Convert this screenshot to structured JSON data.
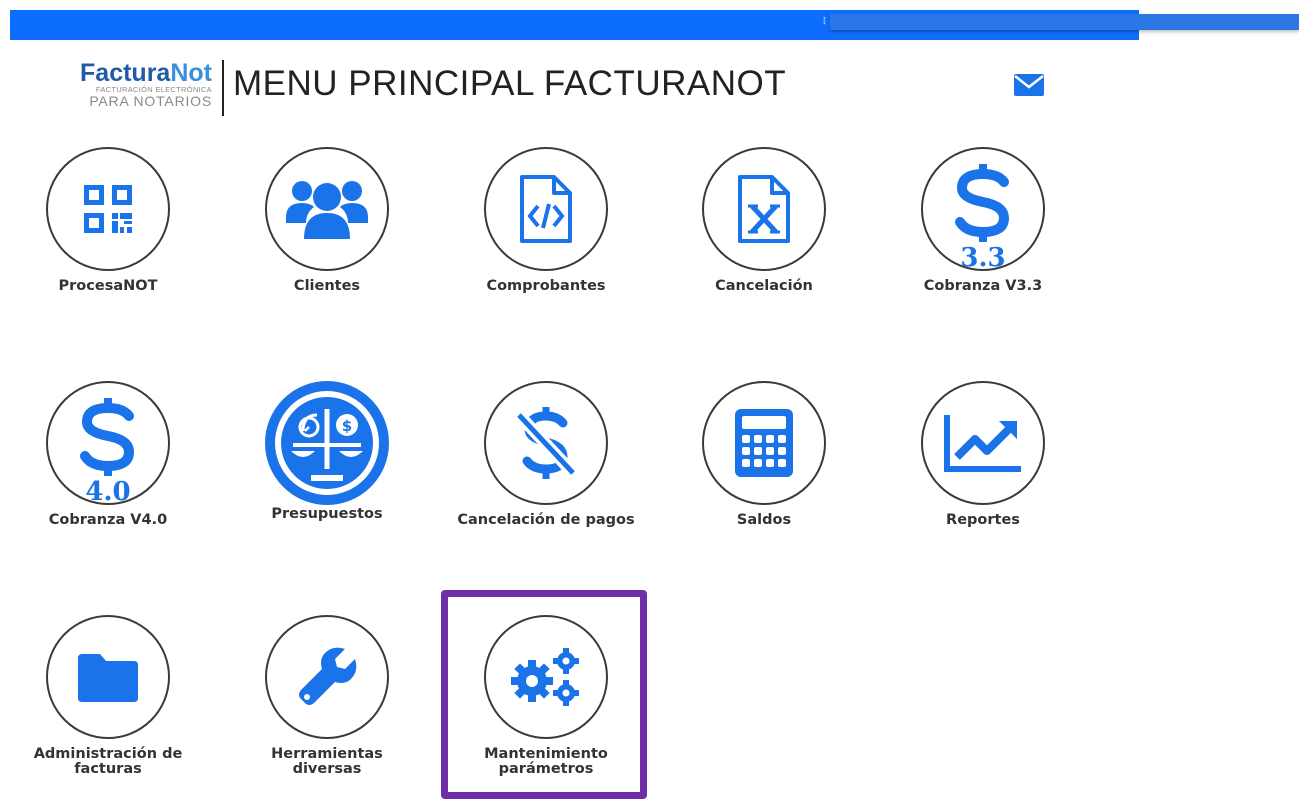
{
  "topbar": {
    "text": "[ F"
  },
  "brand": {
    "name_part1": "Factura",
    "name_part2": "Not",
    "subtitle1": "FACTURACIÓN ELECTRÓNICA",
    "subtitle2": "PARA NOTARIOS"
  },
  "header": {
    "title": "MENU PRINCIPAL FACTURANOT",
    "mail_icon": "envelope-icon"
  },
  "colors": {
    "accent": "#0d6efd",
    "icon_blue": "#1a73e8",
    "highlight": "#6f2da8"
  },
  "menu": {
    "items": [
      {
        "label": "ProcesaNOT",
        "icon": "qr-code-icon"
      },
      {
        "label": "Clientes",
        "icon": "users-icon"
      },
      {
        "label": "Comprobantes",
        "icon": "file-code-icon"
      },
      {
        "label": "Cancelación",
        "icon": "file-excel-icon"
      },
      {
        "label": "Cobranza V3.3",
        "icon": "dollar-icon",
        "badge": "3.3"
      },
      {
        "label": "Cobranza V4.0",
        "icon": "dollar-icon",
        "badge": "4.0"
      },
      {
        "label": "Presupuestos",
        "icon": "balance-scale-icon"
      },
      {
        "label": "Cancelación de pagos",
        "icon": "dollar-slash-icon"
      },
      {
        "label": "Saldos",
        "icon": "calculator-icon"
      },
      {
        "label": "Reportes",
        "icon": "chart-line-icon"
      },
      {
        "label": "Administración de facturas",
        "icon": "folder-icon"
      },
      {
        "label": "Herramientas diversas",
        "icon": "wrench-icon"
      },
      {
        "label": "Mantenimiento parámetros",
        "icon": "gears-icon"
      }
    ]
  }
}
